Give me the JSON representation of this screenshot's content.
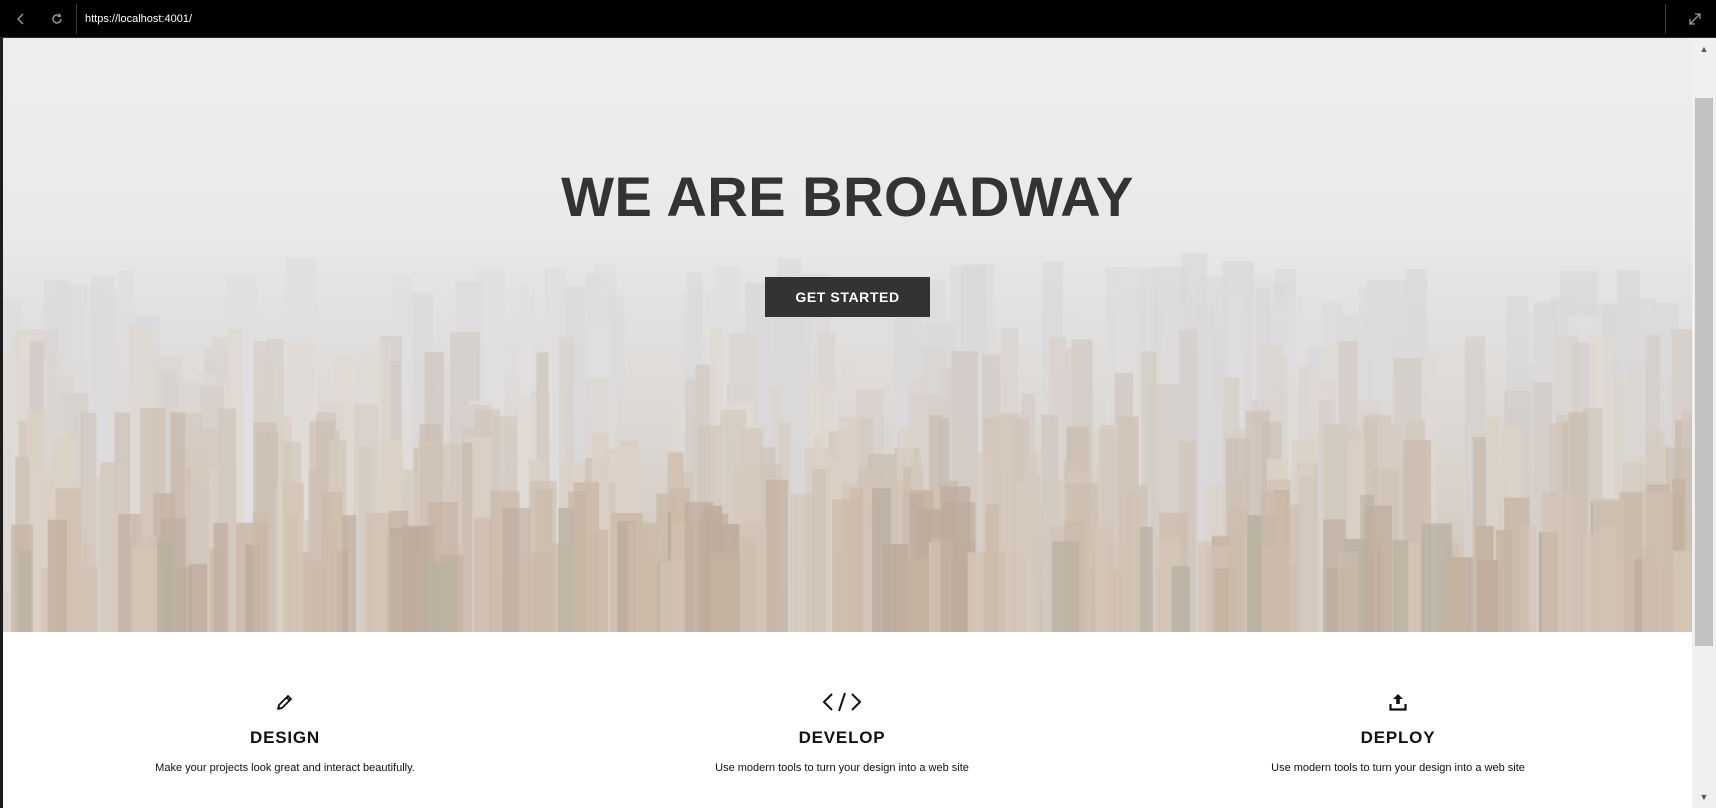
{
  "browser": {
    "url": "https://localhost:4001/"
  },
  "hero": {
    "title": "WE ARE BROADWAY",
    "cta_label": "GET STARTED"
  },
  "features": [
    {
      "icon": "pencil-icon",
      "title": "DESIGN",
      "description": "Make your projects look great and interact beautifully."
    },
    {
      "icon": "code-icon",
      "title": "DEVELOP",
      "description": "Use modern tools to turn your design into a web site"
    },
    {
      "icon": "upload-icon",
      "title": "DEPLOY",
      "description": "Use modern tools to turn your design into a web site"
    }
  ],
  "colors": {
    "button_bg": "#333333",
    "title_text": "#333333",
    "browser_bar": "#000000"
  }
}
